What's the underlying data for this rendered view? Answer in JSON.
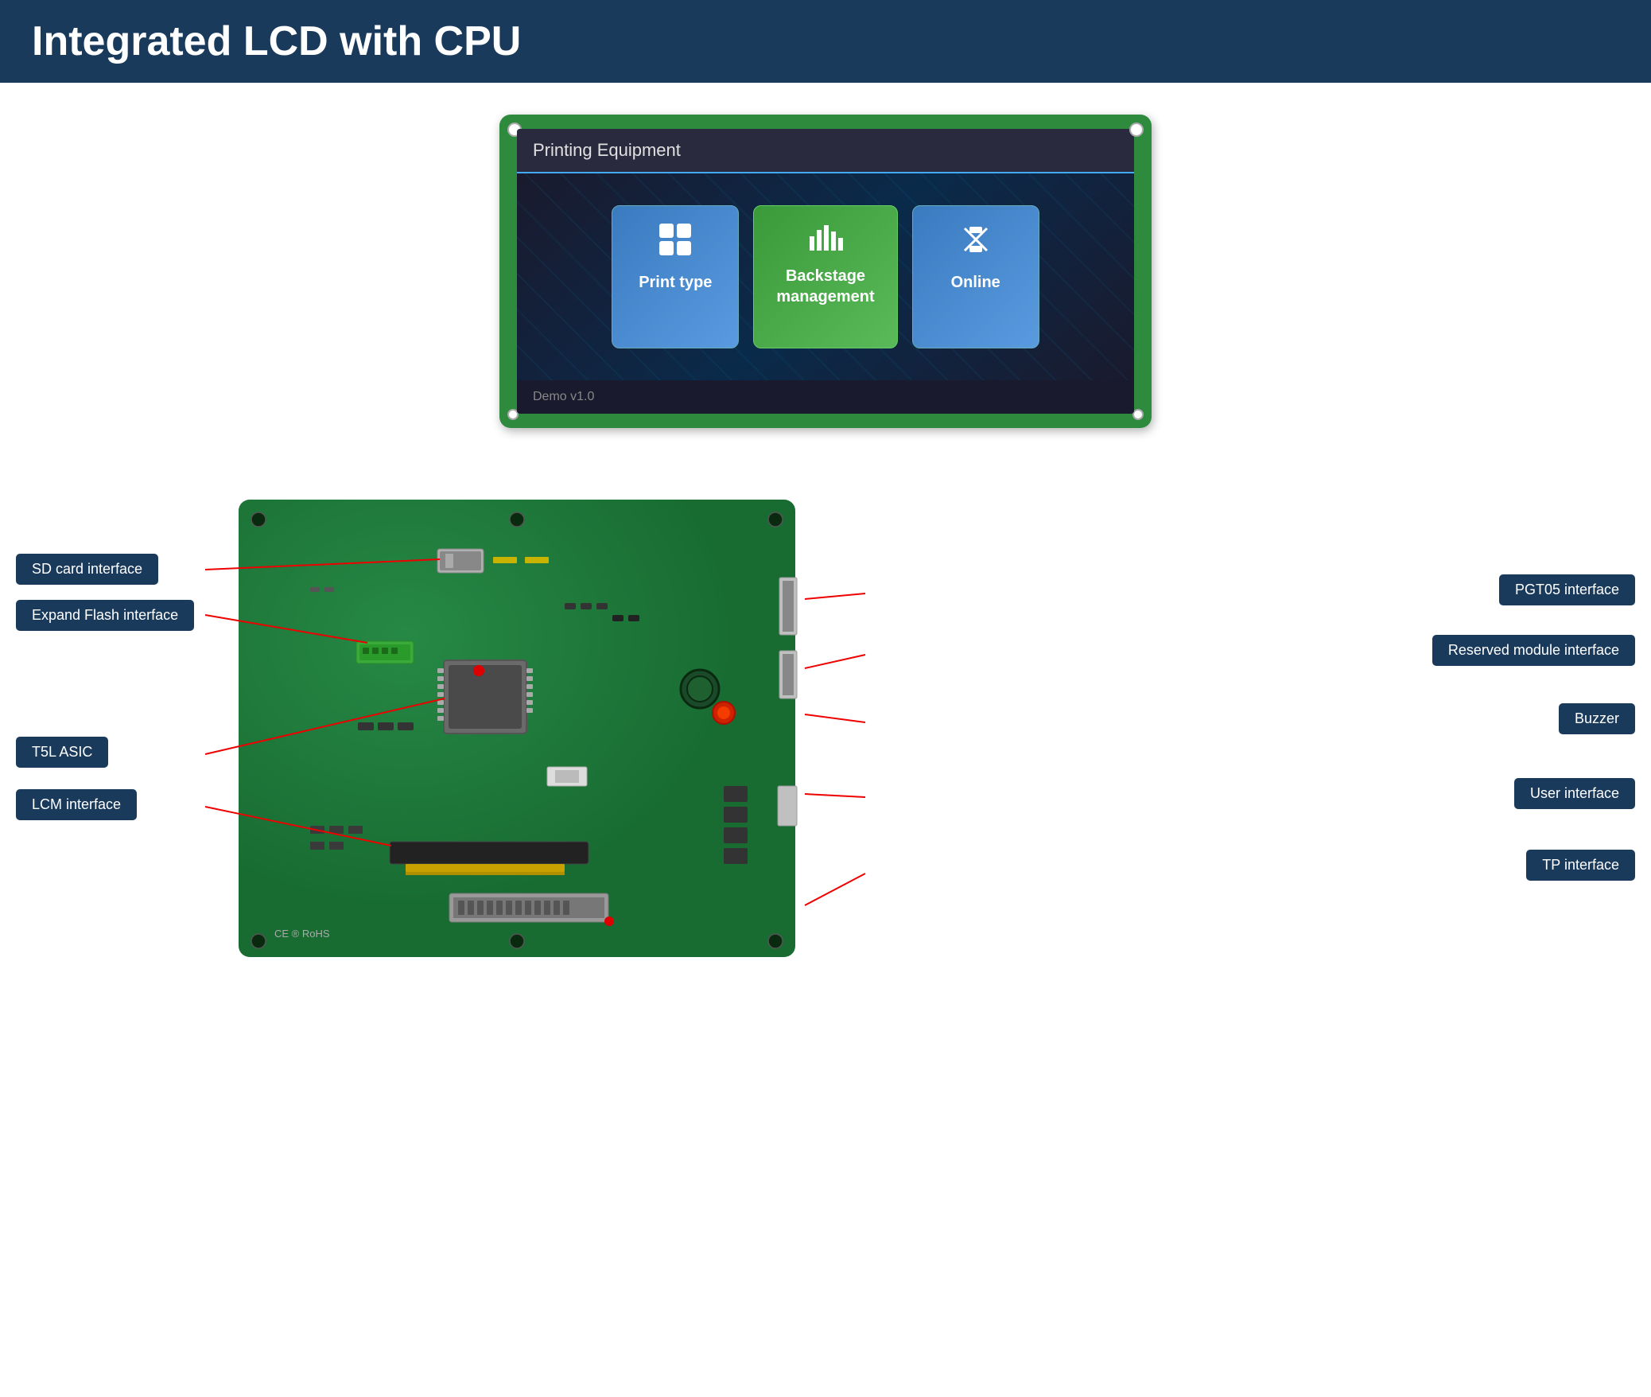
{
  "header": {
    "title": "Integrated LCD with CPU",
    "bg_color": "#1a3a5c"
  },
  "lcd": {
    "title": "Printing Equipment",
    "buttons": [
      {
        "label": "Print type",
        "style": "blue",
        "icon": "⊞"
      },
      {
        "label": "Backstage\nmanagement",
        "style": "green",
        "icon": "📊"
      },
      {
        "label": "Online",
        "style": "blue",
        "icon": "↻"
      }
    ],
    "footer": "Demo v1.0"
  },
  "board": {
    "labels_left": [
      {
        "id": "sd-card",
        "text": "SD card interface"
      },
      {
        "id": "expand-flash",
        "text": "Expand Flash interface"
      },
      {
        "id": "t5l-asic",
        "text": "T5L ASIC"
      },
      {
        "id": "lcm-interface",
        "text": "LCM interface"
      }
    ],
    "labels_right": [
      {
        "id": "pgt05",
        "text": "PGT05 interface"
      },
      {
        "id": "reserved",
        "text": "Reserved module interface"
      },
      {
        "id": "buzzer",
        "text": "Buzzer"
      },
      {
        "id": "user-interface",
        "text": "User interface"
      },
      {
        "id": "tp-interface",
        "text": "TP interface"
      }
    ]
  }
}
